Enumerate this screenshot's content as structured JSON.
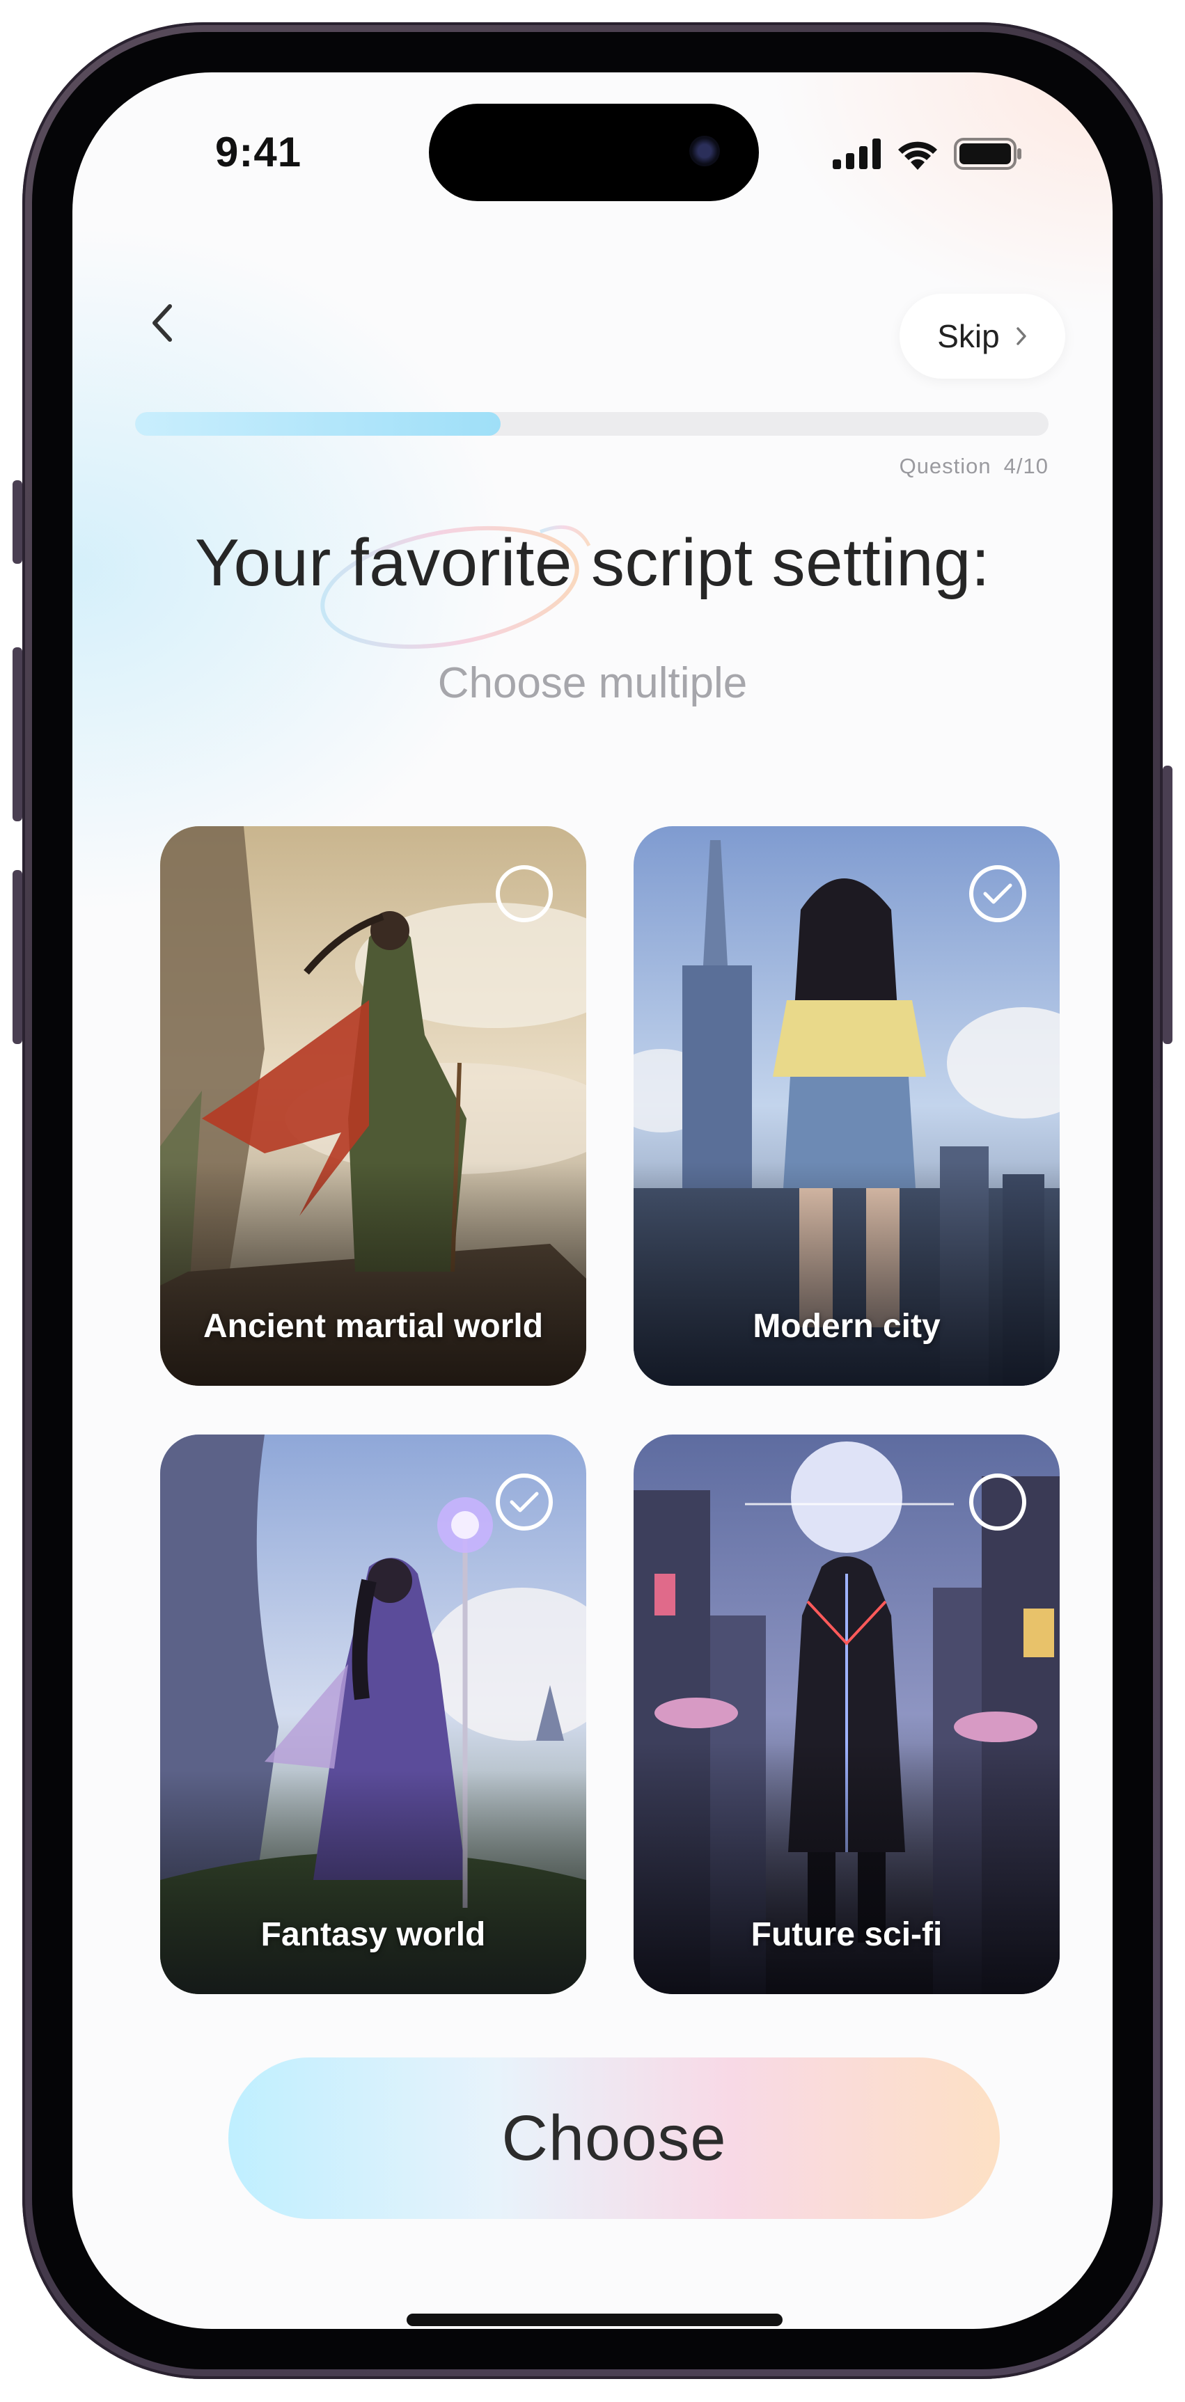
{
  "status_bar": {
    "time": "9:41"
  },
  "nav": {
    "skip_label": "Skip"
  },
  "progress": {
    "value": 0.4,
    "caption_prefix": "Question",
    "caption_count": "4/10"
  },
  "question": {
    "title": "Your favorite script setting:",
    "subtitle": "Choose multiple"
  },
  "options": [
    {
      "label": "Ancient martial world",
      "selected": false
    },
    {
      "label": "Modern city",
      "selected": true
    },
    {
      "label": "Fantasy world",
      "selected": true
    },
    {
      "label": "Future sci-fi",
      "selected": false
    }
  ],
  "cta": {
    "label": "Choose"
  },
  "icons": {
    "back": "chevron-left-icon",
    "skip": "chevron-right-icon",
    "signal": "cellular-signal-icon",
    "wifi": "wifi-icon",
    "battery": "battery-icon",
    "check": "checkmark-icon"
  },
  "colors": {
    "progress_fill": "#9fdff8",
    "cta_gradient_start": "#bfefff",
    "cta_gradient_end": "#fde0c4",
    "text_primary": "#262626",
    "text_secondary": "#a6a6ab"
  }
}
